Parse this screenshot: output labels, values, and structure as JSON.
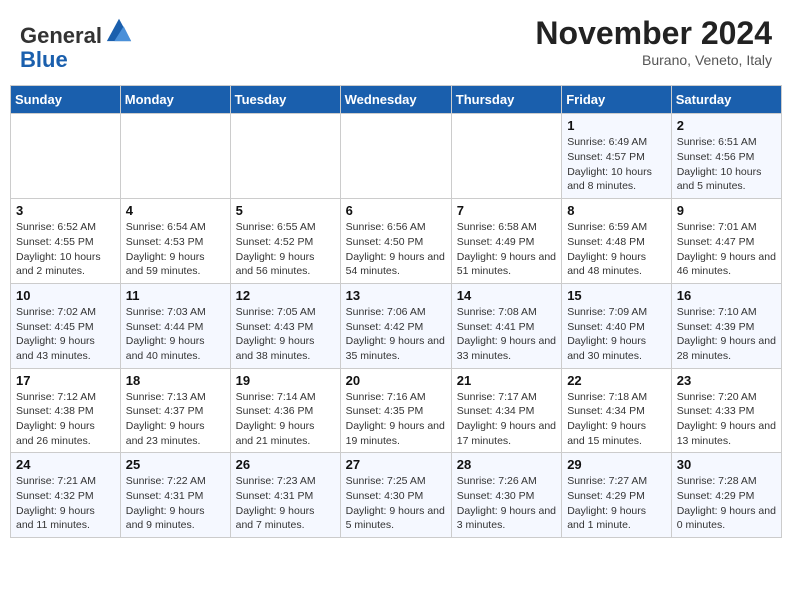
{
  "header": {
    "logo_line1": "General",
    "logo_line2": "Blue",
    "month_title": "November 2024",
    "location": "Burano, Veneto, Italy"
  },
  "days_of_week": [
    "Sunday",
    "Monday",
    "Tuesday",
    "Wednesday",
    "Thursday",
    "Friday",
    "Saturday"
  ],
  "weeks": [
    [
      {
        "day": "",
        "info": ""
      },
      {
        "day": "",
        "info": ""
      },
      {
        "day": "",
        "info": ""
      },
      {
        "day": "",
        "info": ""
      },
      {
        "day": "",
        "info": ""
      },
      {
        "day": "1",
        "info": "Sunrise: 6:49 AM\nSunset: 4:57 PM\nDaylight: 10 hours and 8 minutes."
      },
      {
        "day": "2",
        "info": "Sunrise: 6:51 AM\nSunset: 4:56 PM\nDaylight: 10 hours and 5 minutes."
      }
    ],
    [
      {
        "day": "3",
        "info": "Sunrise: 6:52 AM\nSunset: 4:55 PM\nDaylight: 10 hours and 2 minutes."
      },
      {
        "day": "4",
        "info": "Sunrise: 6:54 AM\nSunset: 4:53 PM\nDaylight: 9 hours and 59 minutes."
      },
      {
        "day": "5",
        "info": "Sunrise: 6:55 AM\nSunset: 4:52 PM\nDaylight: 9 hours and 56 minutes."
      },
      {
        "day": "6",
        "info": "Sunrise: 6:56 AM\nSunset: 4:50 PM\nDaylight: 9 hours and 54 minutes."
      },
      {
        "day": "7",
        "info": "Sunrise: 6:58 AM\nSunset: 4:49 PM\nDaylight: 9 hours and 51 minutes."
      },
      {
        "day": "8",
        "info": "Sunrise: 6:59 AM\nSunset: 4:48 PM\nDaylight: 9 hours and 48 minutes."
      },
      {
        "day": "9",
        "info": "Sunrise: 7:01 AM\nSunset: 4:47 PM\nDaylight: 9 hours and 46 minutes."
      }
    ],
    [
      {
        "day": "10",
        "info": "Sunrise: 7:02 AM\nSunset: 4:45 PM\nDaylight: 9 hours and 43 minutes."
      },
      {
        "day": "11",
        "info": "Sunrise: 7:03 AM\nSunset: 4:44 PM\nDaylight: 9 hours and 40 minutes."
      },
      {
        "day": "12",
        "info": "Sunrise: 7:05 AM\nSunset: 4:43 PM\nDaylight: 9 hours and 38 minutes."
      },
      {
        "day": "13",
        "info": "Sunrise: 7:06 AM\nSunset: 4:42 PM\nDaylight: 9 hours and 35 minutes."
      },
      {
        "day": "14",
        "info": "Sunrise: 7:08 AM\nSunset: 4:41 PM\nDaylight: 9 hours and 33 minutes."
      },
      {
        "day": "15",
        "info": "Sunrise: 7:09 AM\nSunset: 4:40 PM\nDaylight: 9 hours and 30 minutes."
      },
      {
        "day": "16",
        "info": "Sunrise: 7:10 AM\nSunset: 4:39 PM\nDaylight: 9 hours and 28 minutes."
      }
    ],
    [
      {
        "day": "17",
        "info": "Sunrise: 7:12 AM\nSunset: 4:38 PM\nDaylight: 9 hours and 26 minutes."
      },
      {
        "day": "18",
        "info": "Sunrise: 7:13 AM\nSunset: 4:37 PM\nDaylight: 9 hours and 23 minutes."
      },
      {
        "day": "19",
        "info": "Sunrise: 7:14 AM\nSunset: 4:36 PM\nDaylight: 9 hours and 21 minutes."
      },
      {
        "day": "20",
        "info": "Sunrise: 7:16 AM\nSunset: 4:35 PM\nDaylight: 9 hours and 19 minutes."
      },
      {
        "day": "21",
        "info": "Sunrise: 7:17 AM\nSunset: 4:34 PM\nDaylight: 9 hours and 17 minutes."
      },
      {
        "day": "22",
        "info": "Sunrise: 7:18 AM\nSunset: 4:34 PM\nDaylight: 9 hours and 15 minutes."
      },
      {
        "day": "23",
        "info": "Sunrise: 7:20 AM\nSunset: 4:33 PM\nDaylight: 9 hours and 13 minutes."
      }
    ],
    [
      {
        "day": "24",
        "info": "Sunrise: 7:21 AM\nSunset: 4:32 PM\nDaylight: 9 hours and 11 minutes."
      },
      {
        "day": "25",
        "info": "Sunrise: 7:22 AM\nSunset: 4:31 PM\nDaylight: 9 hours and 9 minutes."
      },
      {
        "day": "26",
        "info": "Sunrise: 7:23 AM\nSunset: 4:31 PM\nDaylight: 9 hours and 7 minutes."
      },
      {
        "day": "27",
        "info": "Sunrise: 7:25 AM\nSunset: 4:30 PM\nDaylight: 9 hours and 5 minutes."
      },
      {
        "day": "28",
        "info": "Sunrise: 7:26 AM\nSunset: 4:30 PM\nDaylight: 9 hours and 3 minutes."
      },
      {
        "day": "29",
        "info": "Sunrise: 7:27 AM\nSunset: 4:29 PM\nDaylight: 9 hours and 1 minute."
      },
      {
        "day": "30",
        "info": "Sunrise: 7:28 AM\nSunset: 4:29 PM\nDaylight: 9 hours and 0 minutes."
      }
    ]
  ]
}
